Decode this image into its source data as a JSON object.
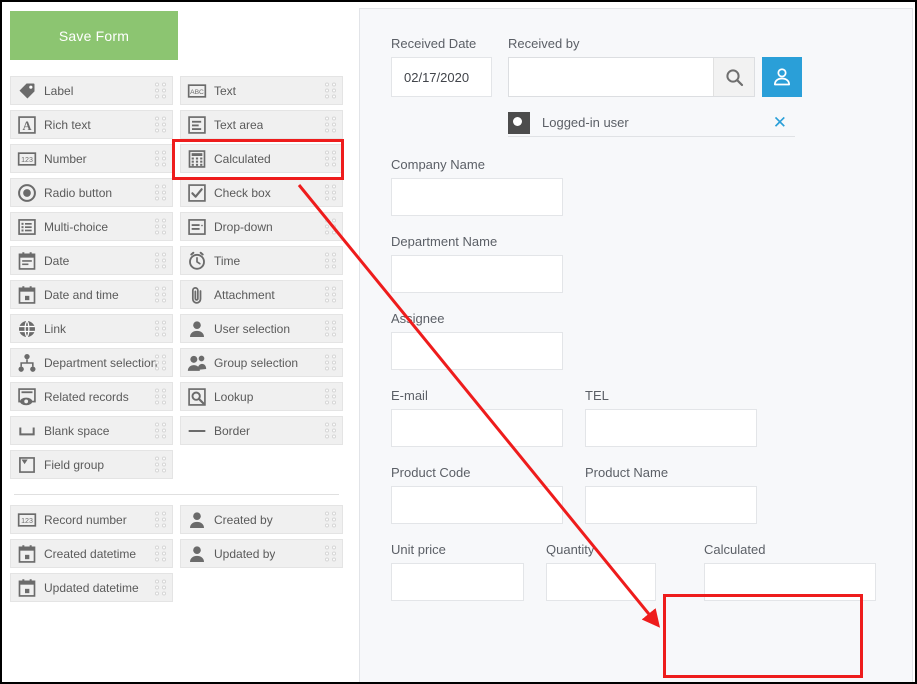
{
  "palette": {
    "save_label": "Save Form",
    "main_fields": [
      [
        {
          "label": "Label",
          "icon": "tag-icon"
        },
        {
          "label": "Text",
          "icon": "abc-text-icon"
        }
      ],
      [
        {
          "label": "Rich text",
          "icon": "rich-text-a-icon"
        },
        {
          "label": "Text area",
          "icon": "text-area-icon"
        }
      ],
      [
        {
          "label": "Number",
          "icon": "number-123-icon"
        },
        {
          "label": "Calculated",
          "icon": "calculator-icon"
        }
      ],
      [
        {
          "label": "Radio button",
          "icon": "radio-button-icon"
        },
        {
          "label": "Check box",
          "icon": "checkbox-icon"
        }
      ],
      [
        {
          "label": "Multi-choice",
          "icon": "multi-choice-icon"
        },
        {
          "label": "Drop-down",
          "icon": "drop-down-icon"
        }
      ],
      [
        {
          "label": "Date",
          "icon": "calendar-icon"
        },
        {
          "label": "Time",
          "icon": "clock-icon"
        }
      ],
      [
        {
          "label": "Date and time",
          "icon": "calendar-clock-icon"
        },
        {
          "label": "Attachment",
          "icon": "paperclip-icon"
        }
      ],
      [
        {
          "label": "Link",
          "icon": "globe-icon"
        },
        {
          "label": "User selection",
          "icon": "user-icon"
        }
      ],
      [
        {
          "label": "Department selection",
          "icon": "org-tree-icon"
        },
        {
          "label": "Group selection",
          "icon": "users-group-icon"
        }
      ],
      [
        {
          "label": "Related records",
          "icon": "related-records-eye-icon"
        },
        {
          "label": "Lookup",
          "icon": "lookup-magnifier-icon"
        }
      ],
      [
        {
          "label": "Blank space",
          "icon": "blank-space-icon"
        },
        {
          "label": "Border",
          "icon": "border-line-icon"
        }
      ],
      [
        {
          "label": "Field group",
          "icon": "field-group-icon"
        }
      ]
    ],
    "system_fields": [
      [
        {
          "label": "Record number",
          "icon": "number-123-icon"
        },
        {
          "label": "Created by",
          "icon": "user-icon"
        }
      ],
      [
        {
          "label": "Created datetime",
          "icon": "calendar-clock-icon"
        },
        {
          "label": "Updated by",
          "icon": "user-icon"
        }
      ],
      [
        {
          "label": "Updated datetime",
          "icon": "calendar-clock-icon"
        }
      ]
    ]
  },
  "form": {
    "received_date": {
      "label": "Received Date",
      "value": "02/17/2020"
    },
    "received_by": {
      "label": "Received by",
      "value": "",
      "search_icon": "search-icon",
      "user_picker_icon": "user-select-icon"
    },
    "selected_user": {
      "name": "Logged-in user",
      "remove_icon": "close-icon",
      "avatar_icon": "user-avatar-icon"
    },
    "fields": [
      {
        "label": "Company Name",
        "value": "",
        "width": 172
      },
      {
        "label": "Department Name",
        "value": "",
        "width": 172
      },
      {
        "label": "Assignee",
        "value": "",
        "width": 172
      }
    ],
    "pair_rows": [
      [
        {
          "label": "E-mail",
          "value": "",
          "width": 172
        },
        {
          "label": "TEL",
          "value": "",
          "width": 172
        }
      ],
      [
        {
          "label": "Product Code",
          "value": "",
          "width": 172
        },
        {
          "label": "Product Name",
          "value": "",
          "width": 172
        }
      ]
    ],
    "bottom_row": [
      {
        "label": "Unit price",
        "value": "",
        "width": 133
      },
      {
        "label": "Quantity",
        "value": "",
        "width": 110
      },
      {
        "label": "Calculated",
        "value": "",
        "width": 172
      }
    ]
  },
  "annotations": {
    "highlight_color": "#ee1c1c",
    "arrow_color": "#ee1c1c",
    "arrow_from": "palette-calculated",
    "arrow_to": "form-calculated"
  },
  "colors": {
    "save_button_green": "#8cc571",
    "user_button_blue": "#2a9fd8",
    "panel_background": "#f7f8fa",
    "palette_item_background": "#f0f0f0"
  }
}
